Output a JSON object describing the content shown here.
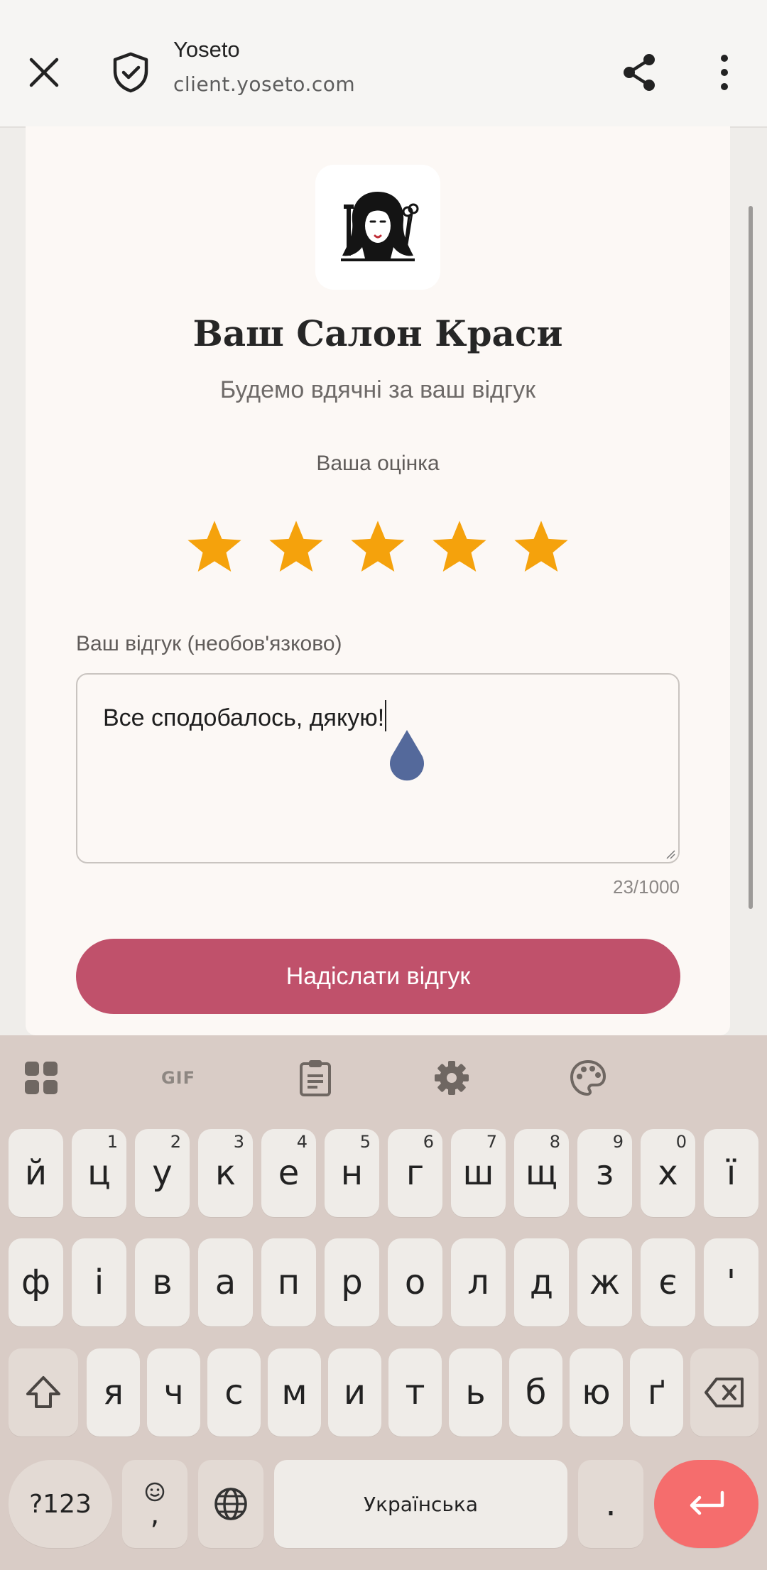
{
  "browser": {
    "site_title": "Yoseto",
    "url": "client.yoseto.com"
  },
  "salon": {
    "title": "Ваш Салон Краси",
    "subtitle": "Будемо вдячні за ваш відгук"
  },
  "rating": {
    "label": "Ваша оцінка",
    "value": 5,
    "max": 5,
    "star_color": "#f5a20c"
  },
  "review": {
    "label": "Ваш відгук (необов'язково)",
    "text": "Все сподобалось, дякую!",
    "counter": "23/1000"
  },
  "submit": {
    "label": "Надіслати відгук",
    "color": "#c0516b"
  },
  "keyboard": {
    "toolbar": [
      "apps-grid-icon",
      "gif-icon",
      "clipboard-icon",
      "settings-icon",
      "palette-icon"
    ],
    "gif_label": "GIF",
    "row1": [
      {
        "k": "й",
        "h": ""
      },
      {
        "k": "ц",
        "h": "1"
      },
      {
        "k": "у",
        "h": "2"
      },
      {
        "k": "к",
        "h": "3"
      },
      {
        "k": "е",
        "h": "4"
      },
      {
        "k": "н",
        "h": "5"
      },
      {
        "k": "г",
        "h": "6"
      },
      {
        "k": "ш",
        "h": "7"
      },
      {
        "k": "щ",
        "h": "8"
      },
      {
        "k": "з",
        "h": "9"
      },
      {
        "k": "х",
        "h": "0"
      },
      {
        "k": "ї",
        "h": ""
      }
    ],
    "row2": [
      "ф",
      "і",
      "в",
      "а",
      "п",
      "р",
      "о",
      "л",
      "д",
      "ж",
      "є",
      "'"
    ],
    "row3": [
      "я",
      "ч",
      "с",
      "м",
      "и",
      "т",
      "ь",
      "б",
      "ю",
      "ґ"
    ],
    "sym_label": "?123",
    "emoji_comma": ",",
    "space_label": "Українська",
    "period": "."
  }
}
